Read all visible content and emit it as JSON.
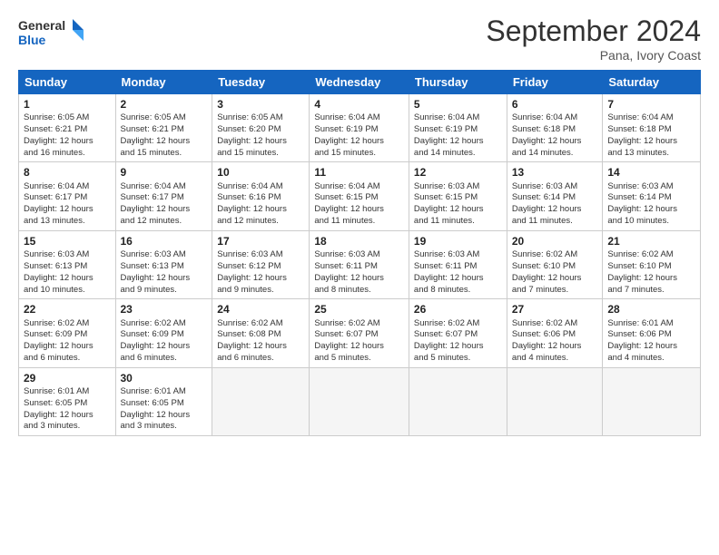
{
  "title": "September 2024",
  "location": "Pana, Ivory Coast",
  "logo": {
    "line1": "General",
    "line2": "Blue"
  },
  "headers": [
    "Sunday",
    "Monday",
    "Tuesday",
    "Wednesday",
    "Thursday",
    "Friday",
    "Saturday"
  ],
  "weeks": [
    [
      {
        "day": "1",
        "sunrise": "6:05 AM",
        "sunset": "6:21 PM",
        "daylight": "12 hours and 16 minutes."
      },
      {
        "day": "2",
        "sunrise": "6:05 AM",
        "sunset": "6:21 PM",
        "daylight": "12 hours and 15 minutes."
      },
      {
        "day": "3",
        "sunrise": "6:05 AM",
        "sunset": "6:20 PM",
        "daylight": "12 hours and 15 minutes."
      },
      {
        "day": "4",
        "sunrise": "6:04 AM",
        "sunset": "6:19 PM",
        "daylight": "12 hours and 15 minutes."
      },
      {
        "day": "5",
        "sunrise": "6:04 AM",
        "sunset": "6:19 PM",
        "daylight": "12 hours and 14 minutes."
      },
      {
        "day": "6",
        "sunrise": "6:04 AM",
        "sunset": "6:18 PM",
        "daylight": "12 hours and 14 minutes."
      },
      {
        "day": "7",
        "sunrise": "6:04 AM",
        "sunset": "6:18 PM",
        "daylight": "12 hours and 13 minutes."
      }
    ],
    [
      {
        "day": "8",
        "sunrise": "6:04 AM",
        "sunset": "6:17 PM",
        "daylight": "12 hours and 13 minutes."
      },
      {
        "day": "9",
        "sunrise": "6:04 AM",
        "sunset": "6:17 PM",
        "daylight": "12 hours and 12 minutes."
      },
      {
        "day": "10",
        "sunrise": "6:04 AM",
        "sunset": "6:16 PM",
        "daylight": "12 hours and 12 minutes."
      },
      {
        "day": "11",
        "sunrise": "6:04 AM",
        "sunset": "6:15 PM",
        "daylight": "12 hours and 11 minutes."
      },
      {
        "day": "12",
        "sunrise": "6:03 AM",
        "sunset": "6:15 PM",
        "daylight": "12 hours and 11 minutes."
      },
      {
        "day": "13",
        "sunrise": "6:03 AM",
        "sunset": "6:14 PM",
        "daylight": "12 hours and 11 minutes."
      },
      {
        "day": "14",
        "sunrise": "6:03 AM",
        "sunset": "6:14 PM",
        "daylight": "12 hours and 10 minutes."
      }
    ],
    [
      {
        "day": "15",
        "sunrise": "6:03 AM",
        "sunset": "6:13 PM",
        "daylight": "12 hours and 10 minutes."
      },
      {
        "day": "16",
        "sunrise": "6:03 AM",
        "sunset": "6:13 PM",
        "daylight": "12 hours and 9 minutes."
      },
      {
        "day": "17",
        "sunrise": "6:03 AM",
        "sunset": "6:12 PM",
        "daylight": "12 hours and 9 minutes."
      },
      {
        "day": "18",
        "sunrise": "6:03 AM",
        "sunset": "6:11 PM",
        "daylight": "12 hours and 8 minutes."
      },
      {
        "day": "19",
        "sunrise": "6:03 AM",
        "sunset": "6:11 PM",
        "daylight": "12 hours and 8 minutes."
      },
      {
        "day": "20",
        "sunrise": "6:02 AM",
        "sunset": "6:10 PM",
        "daylight": "12 hours and 7 minutes."
      },
      {
        "day": "21",
        "sunrise": "6:02 AM",
        "sunset": "6:10 PM",
        "daylight": "12 hours and 7 minutes."
      }
    ],
    [
      {
        "day": "22",
        "sunrise": "6:02 AM",
        "sunset": "6:09 PM",
        "daylight": "12 hours and 6 minutes."
      },
      {
        "day": "23",
        "sunrise": "6:02 AM",
        "sunset": "6:09 PM",
        "daylight": "12 hours and 6 minutes."
      },
      {
        "day": "24",
        "sunrise": "6:02 AM",
        "sunset": "6:08 PM",
        "daylight": "12 hours and 6 minutes."
      },
      {
        "day": "25",
        "sunrise": "6:02 AM",
        "sunset": "6:07 PM",
        "daylight": "12 hours and 5 minutes."
      },
      {
        "day": "26",
        "sunrise": "6:02 AM",
        "sunset": "6:07 PM",
        "daylight": "12 hours and 5 minutes."
      },
      {
        "day": "27",
        "sunrise": "6:02 AM",
        "sunset": "6:06 PM",
        "daylight": "12 hours and 4 minutes."
      },
      {
        "day": "28",
        "sunrise": "6:01 AM",
        "sunset": "6:06 PM",
        "daylight": "12 hours and 4 minutes."
      }
    ],
    [
      {
        "day": "29",
        "sunrise": "6:01 AM",
        "sunset": "6:05 PM",
        "daylight": "12 hours and 3 minutes."
      },
      {
        "day": "30",
        "sunrise": "6:01 AM",
        "sunset": "6:05 PM",
        "daylight": "12 hours and 3 minutes."
      },
      null,
      null,
      null,
      null,
      null
    ]
  ],
  "labels": {
    "sunrise": "Sunrise:",
    "sunset": "Sunset:",
    "daylight": "Daylight:"
  }
}
